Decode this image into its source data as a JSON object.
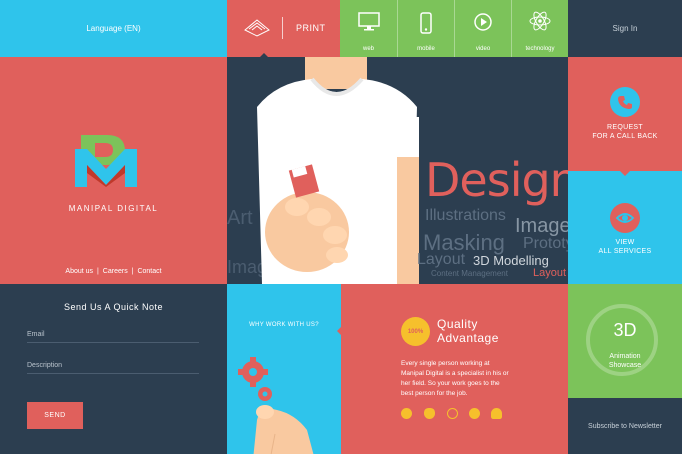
{
  "header": {
    "language": "Language (EN)",
    "print": "PRINT",
    "sign_in": "Sign In",
    "nav": [
      {
        "label": "web",
        "icon": "monitor-icon"
      },
      {
        "label": "mobile",
        "icon": "phone-icon"
      },
      {
        "label": "video",
        "icon": "play-icon"
      },
      {
        "label": "technology",
        "icon": "atom-icon"
      }
    ]
  },
  "brand": {
    "name": "MANIPAL DIGITAL",
    "links": [
      "About us",
      "Careers",
      "Contact"
    ],
    "separator": "|"
  },
  "hero": {
    "words": [
      "Design",
      "Illustrations",
      "Images",
      "Masking",
      "Prototy",
      "Layout",
      "3D Modelling",
      "Content Management",
      "Layout",
      "Image",
      "Art"
    ]
  },
  "side_actions": {
    "callback": "REQUEST\nFOR A CALL BACK",
    "services": "VIEW\nALL SERVICES"
  },
  "contact": {
    "title": "Send Us A Quick Note",
    "email_label": "Email",
    "description_label": "Description",
    "send_label": "SEND"
  },
  "why": {
    "label": "WHY WORK WITH US?"
  },
  "quality": {
    "badge": "100%",
    "title": "Quality\nAdvantage",
    "body": "Every single person working at Manipal Digital is a specialist in his or her field. So your work goes to the best person for the job."
  },
  "showcase": {
    "big": "3D",
    "label": "Animation\nShowcase",
    "subscribe": "Subscribe to Newsletter"
  },
  "colors": {
    "blue": "#2fc4eb",
    "red": "#e0605c",
    "dark": "#2c3e50",
    "green": "#7cc35a",
    "yellow": "#f6c02c"
  }
}
